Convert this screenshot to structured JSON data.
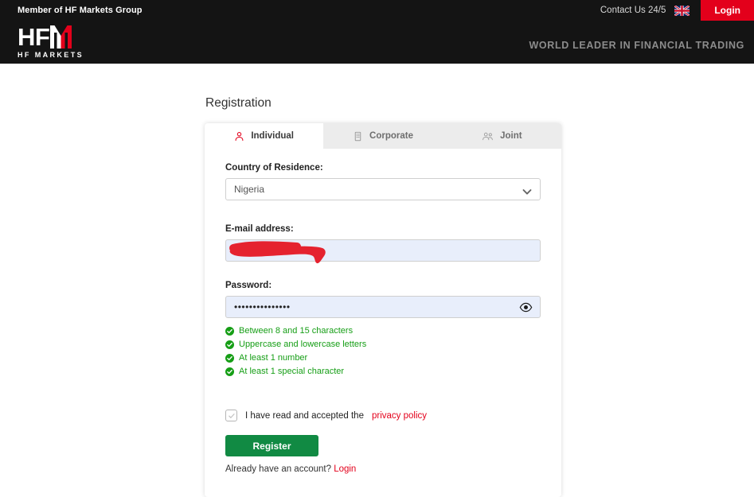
{
  "topbar": {
    "member_text": "Member of HF Markets Group",
    "contact_label": "Contact Us 24/5",
    "flag_icon": "uk-flag-icon",
    "login_label": "Login",
    "login_color": "#e3001b"
  },
  "header": {
    "logo_main": "HF",
    "logo_mark_letter": "M",
    "logo_sub": "HF MARKETS",
    "tagline": "WORLD LEADER IN FINANCIAL TRADING",
    "background": "#141414"
  },
  "page": {
    "title": "Registration"
  },
  "tabs": [
    {
      "label": "Individual",
      "icon": "person-icon",
      "active": true
    },
    {
      "label": "Corporate",
      "icon": "building-icon",
      "active": false
    },
    {
      "label": "Joint",
      "icon": "people-icon",
      "active": false
    }
  ],
  "form": {
    "country": {
      "label": "Country of Residence:",
      "value": "Nigeria",
      "icon": "chevron-down-icon"
    },
    "email": {
      "label": "E-mail address:",
      "value": "",
      "redacted": true,
      "redaction_color": "#e5222f"
    },
    "password": {
      "label": "Password:",
      "value": "•••••••••••••••",
      "toggle_icon": "eye-icon"
    },
    "password_rules": [
      {
        "text": "Between 8 and 15 characters",
        "met": true
      },
      {
        "text": "Uppercase and lowercase letters",
        "met": true
      },
      {
        "text": "At least 1 number",
        "met": true
      },
      {
        "text": "At least 1 special character",
        "met": true
      }
    ],
    "rule_met_color": "#169e16",
    "consent": {
      "checked": true,
      "text": "I have read and accepted the",
      "link_label": "privacy policy"
    },
    "submit_label": "Register",
    "submit_color": "#118a43",
    "footer_text": "Already have an account?",
    "footer_link": "Login"
  }
}
